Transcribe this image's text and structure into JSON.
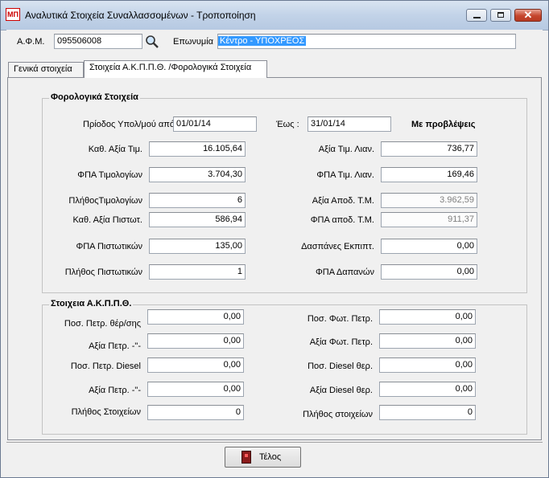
{
  "window": {
    "title": "Αναλυτικά Στοιχεία Συναλλασσομένων - Τροποποίηση",
    "icon_text": "ΜΠ",
    "controls": {
      "minimize": "minimize-icon",
      "maximize": "maximize-icon",
      "close": "close-icon",
      "close_glyph": "✕"
    }
  },
  "header": {
    "afm_label": "Α.Φ.Μ.",
    "afm_value": "095506008",
    "search_icon": "search-icon",
    "name_label": "Επωνυμία",
    "name_value": "Κέντρο - ΥΠΟΧΡΕΟΣ"
  },
  "tabs": [
    {
      "label": "Γενικά στοιχεία",
      "active": false
    },
    {
      "label": "Στοιχεία Α.Κ.Π.Π.Θ. /Φορολογικά  Στοιχεία",
      "active": true
    }
  ],
  "tax_group": {
    "title": "Φορολογικά  Στοιχεία",
    "period_from_label": "Πρίοδος Υπολ/μού από :",
    "period_from": "01/01/14",
    "period_to_label": "Έως :",
    "period_to": "31/01/14",
    "forecast_label": "Με προβλέψεις",
    "left": [
      {
        "label": "Καθ. Αξία Τιμ.",
        "value": "16.105,64"
      },
      {
        "label": "ΦΠΑ Τιμολογίων",
        "value": "3.704,30"
      },
      {
        "label": "ΠλήθοςΤιμολογίων",
        "value": "6"
      },
      {
        "label": "Καθ. Αξία Πιστωτ.",
        "value": "586,94"
      },
      {
        "label": "ΦΠΑ Πιστωτικών",
        "value": "135,00"
      },
      {
        "label": "Πλήθος Πιστωτικών",
        "value": "1"
      }
    ],
    "right": [
      {
        "label": "Αξία  Τιμ. Λιαν.",
        "value": "736,77"
      },
      {
        "label": "ΦΠΑ Τιμ. Λιαν.",
        "value": "169,46"
      },
      {
        "label": "Αξία Αποδ. Τ.Μ.",
        "value": "3.962,59"
      },
      {
        "label": "ΦΠΑ αποδ. Τ.Μ.",
        "value": "911,37"
      },
      {
        "label": "Δασπάνες Εκπιπτ.",
        "value": "0,00"
      },
      {
        "label": "ΦΠΑ Δαπανών",
        "value": "0,00"
      }
    ]
  },
  "akpp_group": {
    "title": "Στοιχεια Α.Κ.Π.Π.Θ.",
    "left": [
      {
        "label": "Ποσ. Πετρ. θέρ/σης",
        "value": "0,00"
      },
      {
        "label": "Αξία Πετρ.   -\"-",
        "value": "0,00"
      },
      {
        "label": "Ποσ. Πετρ. Diesel",
        "value": "0,00"
      },
      {
        "label": "Αξία Πετρ.    -\"-",
        "value": "0,00"
      },
      {
        "label": "Πλήθος Στοιχείων",
        "value": "0"
      }
    ],
    "right": [
      {
        "label": "Ποσ. Φωτ. Πετρ.",
        "value": "0,00"
      },
      {
        "label": "Αξία Φωτ. Πετρ.",
        "value": "0,00"
      },
      {
        "label": "Ποσ. Diesel θερ.",
        "value": "0,00"
      },
      {
        "label": "Αξία Diesel θερ.",
        "value": "0,00"
      },
      {
        "label": "Πλήθος στοιχείων",
        "value": "0"
      }
    ]
  },
  "footer": {
    "end_button": "Τέλος",
    "end_icon": "exit-door-icon"
  }
}
